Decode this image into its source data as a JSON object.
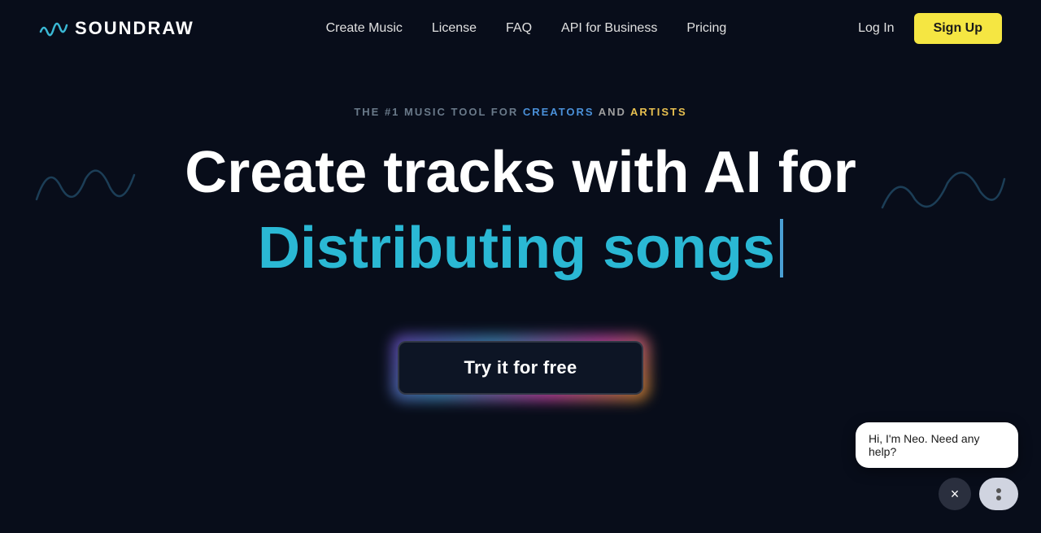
{
  "navbar": {
    "logo_text": "SOUNDRAW",
    "links": [
      {
        "id": "create-music",
        "label": "Create Music"
      },
      {
        "id": "license",
        "label": "License"
      },
      {
        "id": "faq",
        "label": "FAQ"
      },
      {
        "id": "api-for-business",
        "label": "API for Business"
      },
      {
        "id": "pricing",
        "label": "Pricing"
      }
    ],
    "login_label": "Log In",
    "signup_label": "Sign Up"
  },
  "hero": {
    "tagline_prefix": "THE #1 MUSIC TOOL FOR ",
    "tagline_creators": "CREATORS",
    "tagline_and": " AND ",
    "tagline_artists": "ARTISTS",
    "title_line1": "Create tracks with AI for",
    "title_line2": "Distributing songs",
    "cta_label": "Try it for free"
  },
  "chat": {
    "bubble_text": "Hi, I'm Neo. Need any help?",
    "close_icon": "×"
  }
}
